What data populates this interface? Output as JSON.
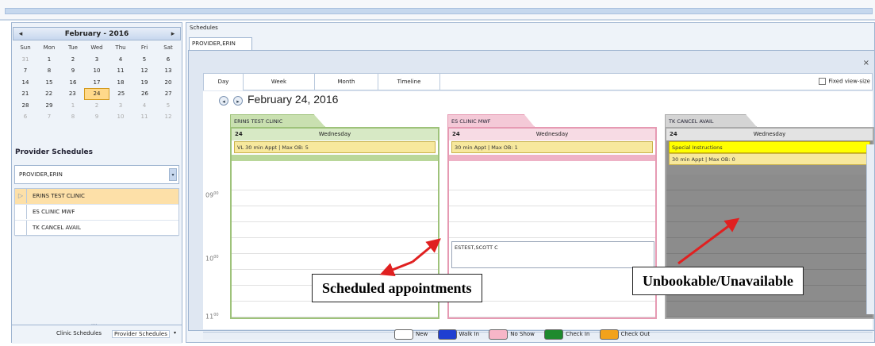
{
  "calendar": {
    "title": "February - 2016",
    "prev": "◂",
    "next": "▸",
    "dow": [
      "Sun",
      "Mon",
      "Tue",
      "Wed",
      "Thu",
      "Fri",
      "Sat"
    ],
    "weeks": [
      [
        "31",
        "1",
        "2",
        "3",
        "4",
        "5",
        "6"
      ],
      [
        "7",
        "8",
        "9",
        "10",
        "11",
        "12",
        "13"
      ],
      [
        "14",
        "15",
        "16",
        "17",
        "18",
        "19",
        "20"
      ],
      [
        "21",
        "22",
        "23",
        "24",
        "25",
        "26",
        "27"
      ],
      [
        "28",
        "29",
        "1",
        "2",
        "3",
        "4",
        "5"
      ],
      [
        "6",
        "7",
        "8",
        "9",
        "10",
        "11",
        "12"
      ]
    ],
    "selected": "24"
  },
  "provider_schedules": {
    "title": "Provider Schedules",
    "selected_provider": "PROVIDER,ERIN",
    "list": [
      "ERINS TEST CLINIC",
      "ES CLINIC MWF",
      "TK CANCEL AVAIL"
    ],
    "bottom_tabs": [
      "Clinic Schedules",
      "Provider Schedules"
    ]
  },
  "schedules": {
    "label": "Schedules",
    "provider_tab": "PROVIDER,ERIN",
    "view_tabs": [
      "Day",
      "Week",
      "Month",
      "Timeline"
    ],
    "fixed_view": "Fixed view-size",
    "date": "February 24, 2016",
    "times": [
      {
        "h": "09",
        "m": "00"
      },
      {
        "h": "10",
        "m": "00"
      },
      {
        "h": "11",
        "m": "00"
      }
    ],
    "columns": [
      {
        "name": "ERINS TEST CLINIC",
        "day_num": "24",
        "day": "Wednesday",
        "info": "VL 30 min Appt | Max OB: 5",
        "color": "#9ec27a",
        "tab_bg": "#c9e0b0"
      },
      {
        "name": "ES CLINIC MWF",
        "day_num": "24",
        "day": "Wednesday",
        "info": "30 min Appt | Max OB: 1",
        "color": "#e69ab3",
        "tab_bg": "#f4c9d7",
        "appointment": "ESTEST,SCOTT C"
      },
      {
        "name": "TK CANCEL AVAIL",
        "day_num": "24",
        "day": "Wednesday",
        "special": "Special Instructions",
        "info": "30 min Appt | Max OB: 0",
        "color": "#aaaaaa",
        "tab_bg": "#d4d4d4"
      }
    ]
  },
  "legend": [
    {
      "label": "New",
      "color": "#ffffff"
    },
    {
      "label": "Walk In",
      "color": "#1f3fd1"
    },
    {
      "label": "No Show",
      "color": "#f7b6c8"
    },
    {
      "label": "Check In",
      "color": "#1e8a2e"
    },
    {
      "label": "Check Out",
      "color": "#f2a21b"
    }
  ],
  "annotations": {
    "scheduled": "Scheduled appointments",
    "unbookable": "Unbookable/Unavailable",
    "arrow_color": "#e02020"
  }
}
